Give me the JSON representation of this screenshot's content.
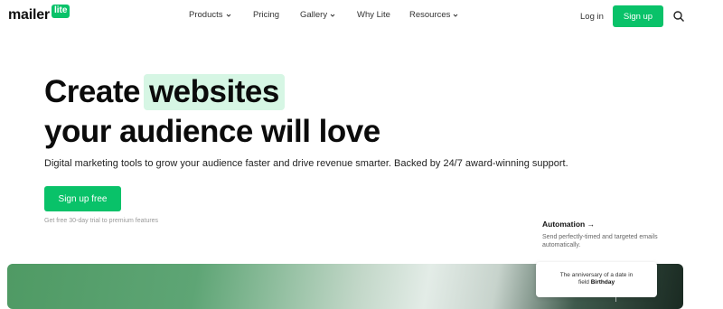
{
  "header": {
    "logo_word": "mailer",
    "logo_badge": "lite",
    "nav": [
      {
        "label": "Products",
        "has_dropdown": true
      },
      {
        "label": "Pricing",
        "has_dropdown": false
      },
      {
        "label": "Gallery",
        "has_dropdown": true
      },
      {
        "label": "Why Lite",
        "has_dropdown": false
      },
      {
        "label": "Resources",
        "has_dropdown": true
      }
    ],
    "login_label": "Log in",
    "signup_label": "Sign up",
    "search_icon": "search-icon"
  },
  "hero": {
    "title_prefix": "Create",
    "title_highlight": "websites",
    "title_line2": "your audience will love",
    "subtitle": "Digital marketing tools to grow your audience faster and drive revenue smarter. Backed by 24/7 award-winning support.",
    "cta_label": "Sign up free",
    "trial_note": "Get free 30-day trial to premium features"
  },
  "feature": {
    "title": "Automation →",
    "description": "Send perfectly-timed and targeted emails automatically."
  },
  "tooltip": {
    "line1": "The anniversary of a date in",
    "line2_prefix": "field",
    "line2_bold": "Birthday"
  },
  "colors": {
    "brand_green": "#09c269",
    "highlight_bg": "#d6f6e4"
  }
}
